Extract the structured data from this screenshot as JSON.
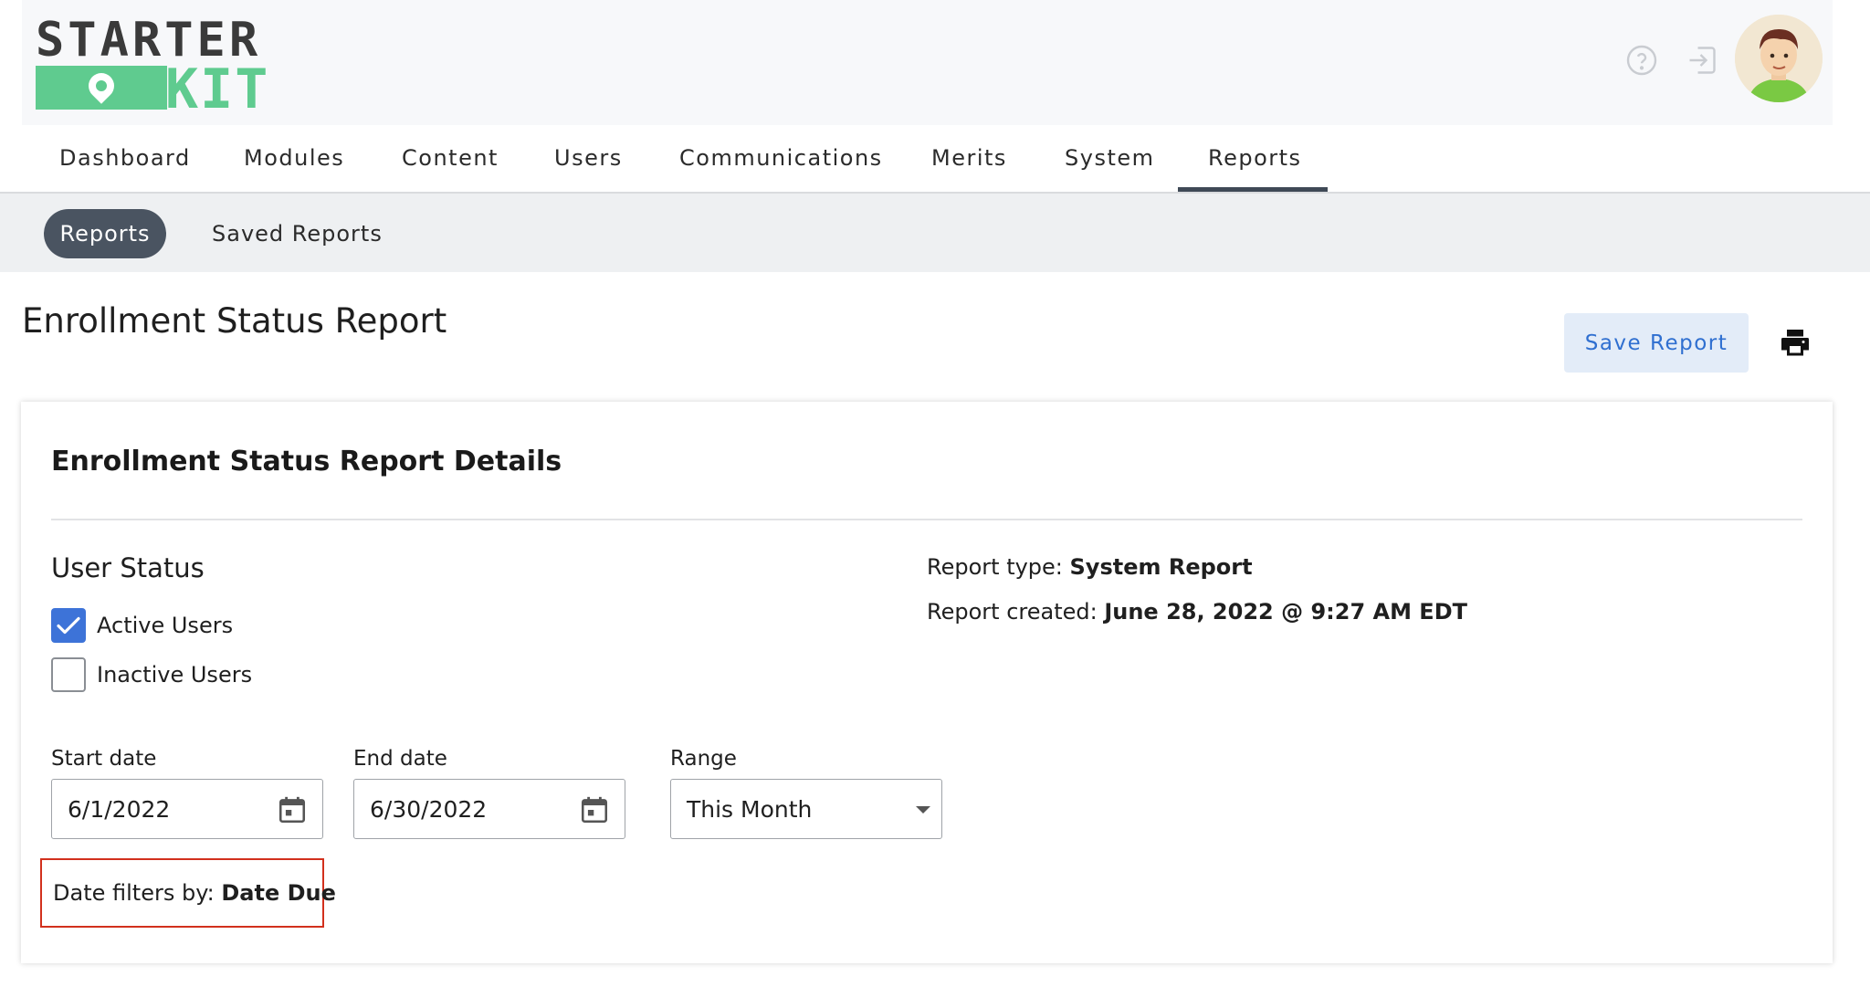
{
  "logo": {
    "top": "STARTER",
    "bottom": "KIT"
  },
  "header": {
    "help_icon": "help-circle-icon",
    "exit_icon": "exit-icon"
  },
  "nav": {
    "items": [
      "Dashboard",
      "Modules",
      "Content",
      "Users",
      "Communications",
      "Merits",
      "System",
      "Reports"
    ],
    "active": "Reports"
  },
  "subnav": {
    "active": "Reports",
    "other": "Saved Reports"
  },
  "page": {
    "title": "Enrollment Status Report",
    "save_label": "Save Report",
    "print_icon": "printer-icon"
  },
  "card": {
    "title": "Enrollment Status Report Details",
    "user_status": {
      "title": "User Status",
      "options": [
        {
          "label": "Active Users",
          "checked": true
        },
        {
          "label": "Inactive Users",
          "checked": false
        }
      ]
    },
    "meta": {
      "type_label": "Report type: ",
      "type_value": "System Report",
      "created_label": "Report created: ",
      "created_value": "June 28, 2022 @ 9:27 AM EDT"
    },
    "fields": {
      "start_label": "Start date",
      "start_value": "6/1/2022",
      "end_label": "End date",
      "end_value": "6/30/2022",
      "range_label": "Range",
      "range_value": "This Month"
    },
    "note": {
      "label": "Date filters by: ",
      "value": "Date Due"
    }
  },
  "colors": {
    "accent": "#3d73d8",
    "logo_green": "#5fcb8f",
    "pill": "#4a5461",
    "highlight_border": "#d2301d"
  }
}
